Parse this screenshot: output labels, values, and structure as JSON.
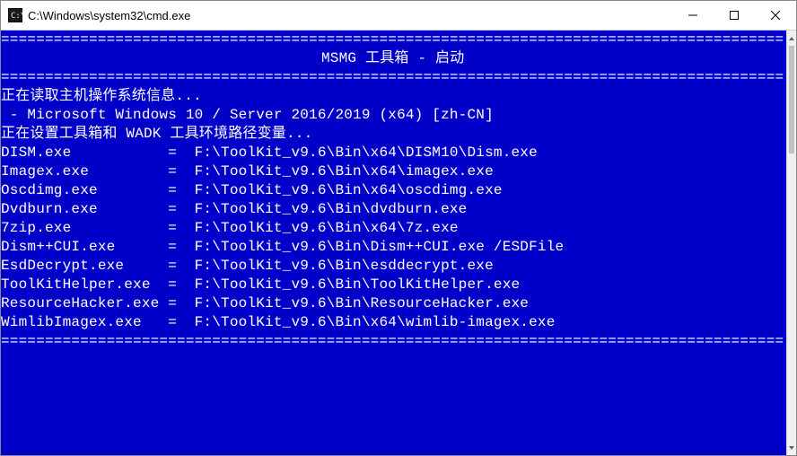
{
  "window": {
    "title": "C:\\Windows\\system32\\cmd.exe"
  },
  "colors": {
    "terminal_bg": "rgb(0,0,200)",
    "terminal_fg": "#ffffff"
  },
  "banner": {
    "rule": "===============================================================================",
    "title": "MSMG 工具箱 - 启动"
  },
  "body": {
    "reading_host": "正在读取主机操作系统信息...",
    "os_line": " - Microsoft Windows 10 / Server 2016/2019 (x64) [zh-CN]",
    "setting_env": "正在设置工具箱和 WADK 工具环境路径变量..."
  },
  "tools": [
    {
      "name": "DISM.exe",
      "path": "F:\\ToolKit_v9.6\\Bin\\x64\\DISM10\\Dism.exe"
    },
    {
      "name": "Imagex.exe",
      "path": "F:\\ToolKit_v9.6\\Bin\\x64\\imagex.exe"
    },
    {
      "name": "Oscdimg.exe",
      "path": "F:\\ToolKit_v9.6\\Bin\\x64\\oscdimg.exe"
    },
    {
      "name": "Dvdburn.exe",
      "path": "F:\\ToolKit_v9.6\\Bin\\dvdburn.exe"
    },
    {
      "name": "7zip.exe",
      "path": "F:\\ToolKit_v9.6\\Bin\\x64\\7z.exe"
    },
    {
      "name": "Dism++CUI.exe",
      "path": "F:\\ToolKit_v9.6\\Bin\\Dism++CUI.exe /ESDFile"
    },
    {
      "name": "EsdDecrypt.exe",
      "path": "F:\\ToolKit_v9.6\\Bin\\esddecrypt.exe"
    },
    {
      "name": "ToolKitHelper.exe",
      "path": "F:\\ToolKit_v9.6\\Bin\\ToolKitHelper.exe"
    },
    {
      "name": "ResourceHacker.exe",
      "path": "F:\\ToolKit_v9.6\\Bin\\ResourceHacker.exe"
    },
    {
      "name": "WimlibImagex.exe",
      "path": "F:\\ToolKit_v9.6\\Bin\\x64\\wimlib-imagex.exe"
    }
  ],
  "tool_name_col_width": 18,
  "footer_rule": "==============================================================================="
}
